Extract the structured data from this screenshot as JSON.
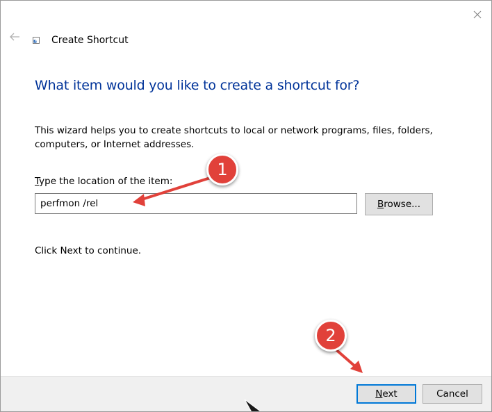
{
  "window": {
    "title": "Create Shortcut",
    "close_icon": "close-icon",
    "back_icon": "back-arrow-icon"
  },
  "main": {
    "heading": "What item would you like to create a shortcut for?",
    "description": "This wizard helps you to create shortcuts to local or network programs, files, folders, computers, or Internet addresses.",
    "location_label": {
      "access_key": "T",
      "rest": "ype the location of the item:"
    },
    "location_value": "perfmon /rel",
    "browse": {
      "access_key": "B",
      "rest": "rowse..."
    },
    "continue_text": "Click Next to continue."
  },
  "footer": {
    "next": {
      "access_key": "N",
      "rest": "ext"
    },
    "cancel": "Cancel"
  },
  "annotations": {
    "marker1": "1",
    "marker2": "2",
    "color": "#e1413a"
  },
  "colors": {
    "heading": "#003399",
    "focus_border": "#0078d7",
    "footer_bg": "#f0f0f0"
  }
}
